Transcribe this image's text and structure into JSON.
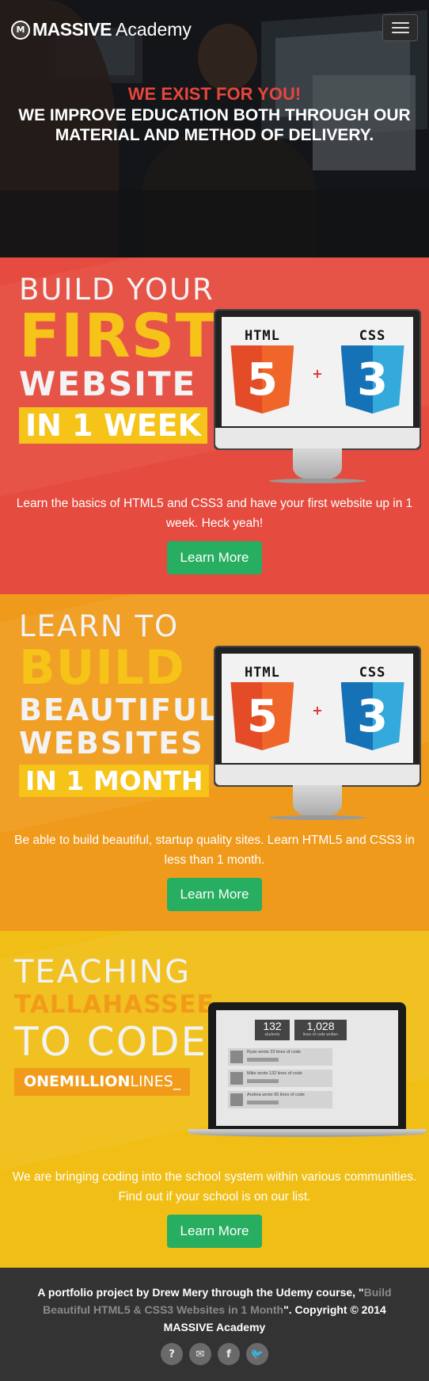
{
  "nav": {
    "brand_name": "MASSIVE",
    "brand_sub": "Academy",
    "menu_icon": "hamburger-icon"
  },
  "hero": {
    "tagline": "WE EXIST FOR YOU!",
    "headline": "WE IMPROVE EDUCATION BOTH THROUGH OUR MATERIAL AND METHOD OF DELIVERY."
  },
  "features": [
    {
      "art_lines": [
        "BUILD YOUR",
        "FIRST",
        "WEBSITE",
        "IN 1 WEEK"
      ],
      "badges": [
        "HTML",
        "CSS"
      ],
      "html_glyph": "5",
      "css_glyph": "3",
      "plus": "+",
      "description": "Learn the basics of HTML5 and CSS3 and have your first website up in 1 week. Heck yeah!",
      "button": "Learn More"
    },
    {
      "art_lines": [
        "LEARN TO",
        "BUILD",
        "BEAUTIFUL",
        "WEBSITES",
        "IN 1 MONTH"
      ],
      "badges": [
        "HTML",
        "CSS"
      ],
      "html_glyph": "5",
      "css_glyph": "3",
      "plus": "+",
      "description": "Be able to build beautiful, startup quality sites. Learn HTML5 and CSS3 in less than 1 month.",
      "button": "Learn More"
    },
    {
      "art_lines": [
        "TEACHING",
        "TALLAHASSEE",
        "TO CODE",
        "ONEMILLION",
        "LINES_"
      ],
      "stats": [
        {
          "num": "132",
          "label": "students"
        },
        {
          "num": "1,028",
          "label": "lines of code written"
        }
      ],
      "feed": [
        "Ryan wrote 23 lines of code",
        "Mike wrote 132 lines of code",
        "Andrea wrote 65 lines of code"
      ],
      "description": "We are bringing coding into the school system within various communities. Find out if your school is on our list.",
      "button": "Learn More"
    }
  ],
  "footer": {
    "text_before": "A portfolio project by Drew Mery through the Udemy course, \"",
    "link": "Build Beautiful HTML5 & CSS3 Websites in 1 Month",
    "text_after": "\". Copyright © 2014 MASSIVE Academy",
    "social": [
      {
        "icon": "question-icon",
        "glyph": "?"
      },
      {
        "icon": "envelope-icon",
        "glyph": "✉"
      },
      {
        "icon": "facebook-icon",
        "glyph": "f"
      },
      {
        "icon": "twitter-icon",
        "glyph": "🐦"
      }
    ]
  },
  "colors": {
    "red_section": "#e54b3f",
    "orange_section": "#f09a1c",
    "yellow_section": "#f0be15",
    "button_green": "#27ae60",
    "footer_bg": "#333333",
    "tagline_red": "#e8453b"
  }
}
